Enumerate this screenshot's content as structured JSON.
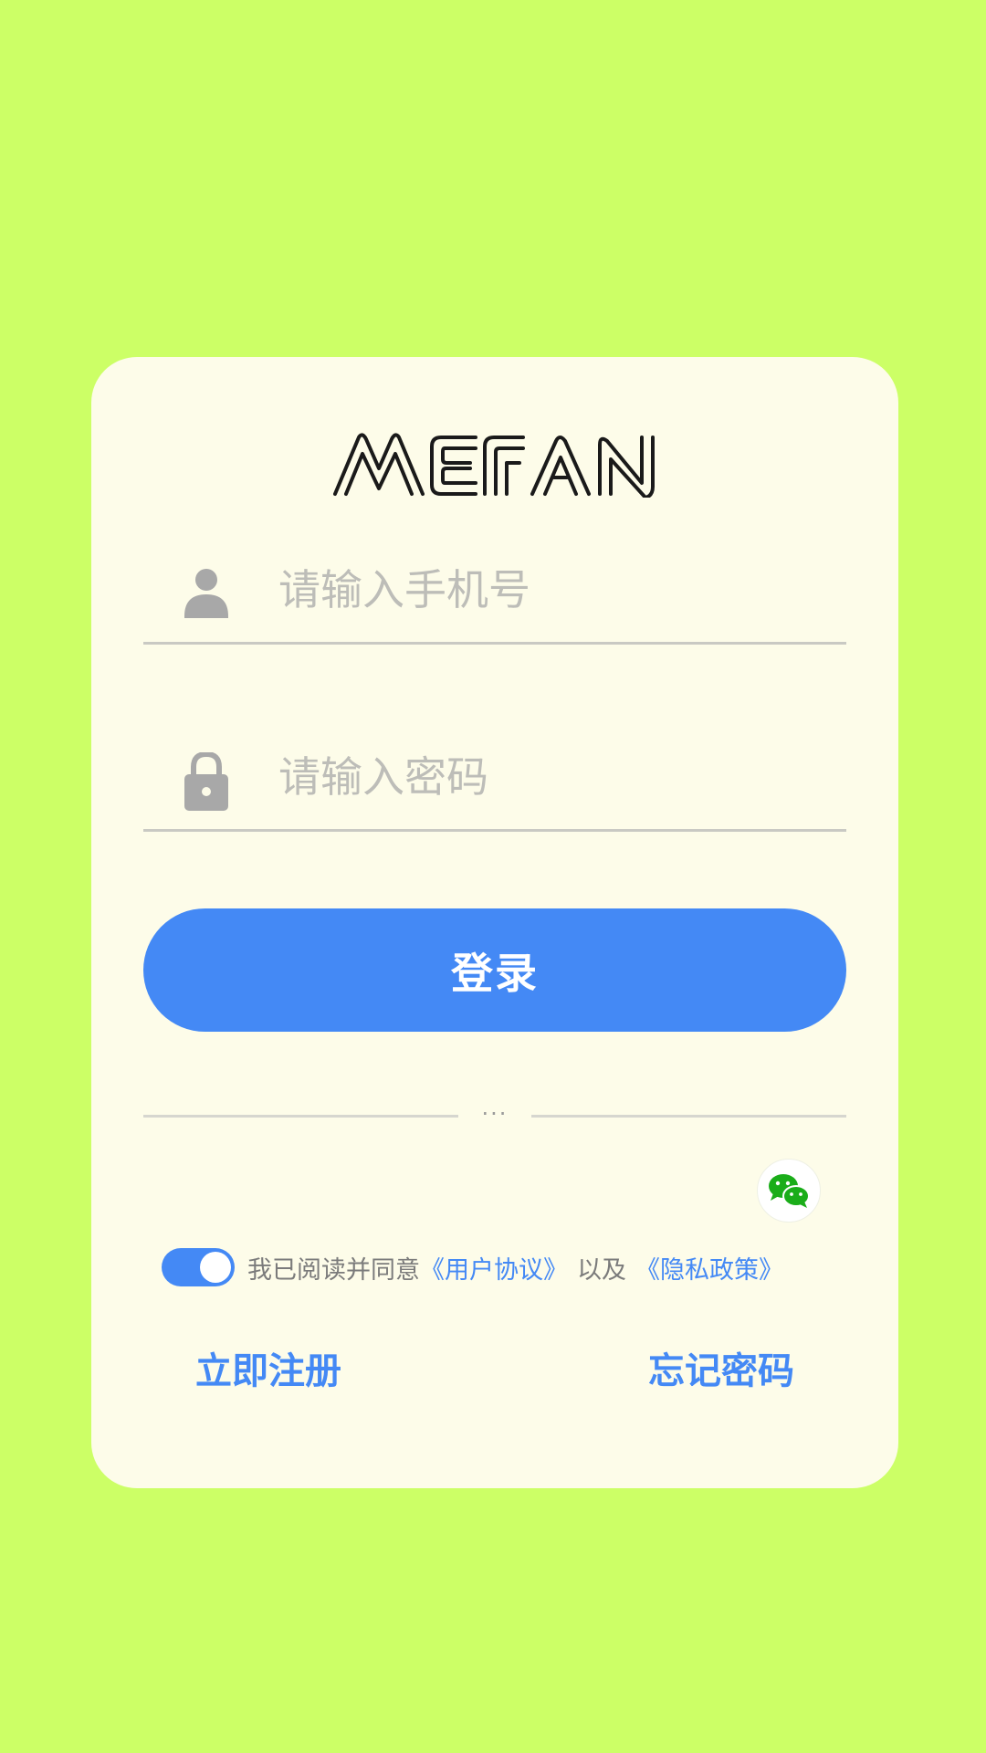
{
  "brand": {
    "logo_text": "MEFAN"
  },
  "form": {
    "phone_placeholder": "请输入手机号",
    "password_placeholder": "请输入密码",
    "login_label": "登录"
  },
  "divider": {
    "dots": "···"
  },
  "social": {
    "icon": "wechat-icon",
    "color": "#1aad19"
  },
  "agreement": {
    "checked": true,
    "prefix": "我已阅读并同意",
    "user_agreement": "《用户协议》",
    "separator": "以及",
    "privacy_policy": "《隐私政策》"
  },
  "links": {
    "register": "立即注册",
    "forgot_password": "忘记密码"
  },
  "colors": {
    "background": "#ccff66",
    "card": "#fdfce9",
    "accent": "#4489f5"
  }
}
